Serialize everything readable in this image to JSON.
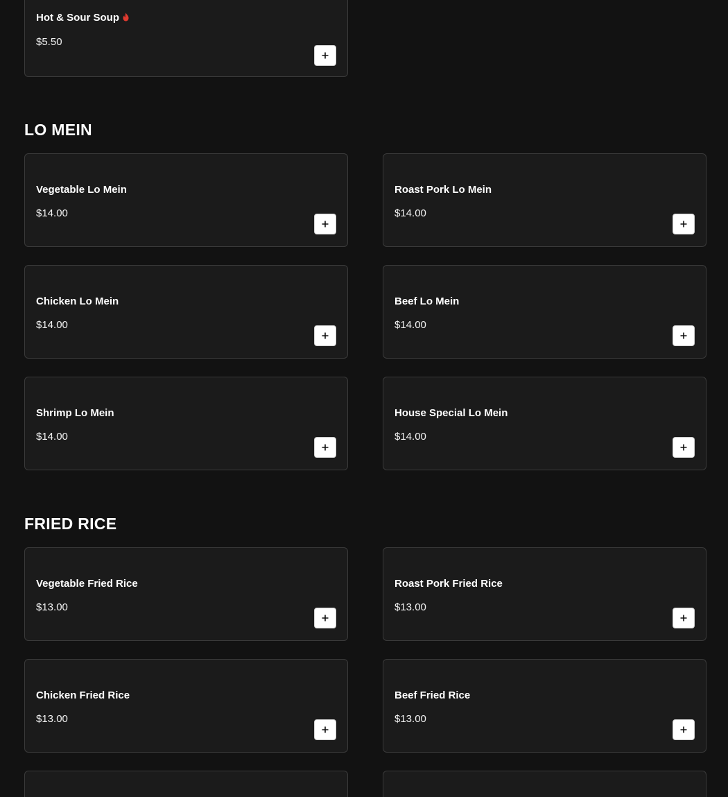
{
  "top_item": {
    "name": "Hot & Sour Soup",
    "price": "$5.50",
    "icon": "flame-icon",
    "icon_color": "#e03a2f"
  },
  "sections": [
    {
      "title": "LO MEIN",
      "items": [
        {
          "name": "Vegetable Lo Mein",
          "price": "$14.00"
        },
        {
          "name": "Roast Pork Lo Mein",
          "price": "$14.00"
        },
        {
          "name": "Chicken Lo Mein",
          "price": "$14.00"
        },
        {
          "name": "Beef Lo Mein",
          "price": "$14.00"
        },
        {
          "name": "Shrimp Lo Mein",
          "price": "$14.00"
        },
        {
          "name": "House Special Lo Mein",
          "price": "$14.00"
        }
      ]
    },
    {
      "title": "FRIED RICE",
      "items": [
        {
          "name": "Vegetable Fried Rice",
          "price": "$13.00"
        },
        {
          "name": "Roast Pork Fried Rice",
          "price": "$13.00"
        },
        {
          "name": "Chicken Fried Rice",
          "price": "$13.00"
        },
        {
          "name": "Beef Fried Rice",
          "price": "$13.00"
        }
      ]
    }
  ],
  "add_button_icon": "plus-icon",
  "colors": {
    "background": "#121212",
    "card": "#1b1b1b",
    "card_border": "#3a3a3a",
    "button": "#ffffff"
  }
}
